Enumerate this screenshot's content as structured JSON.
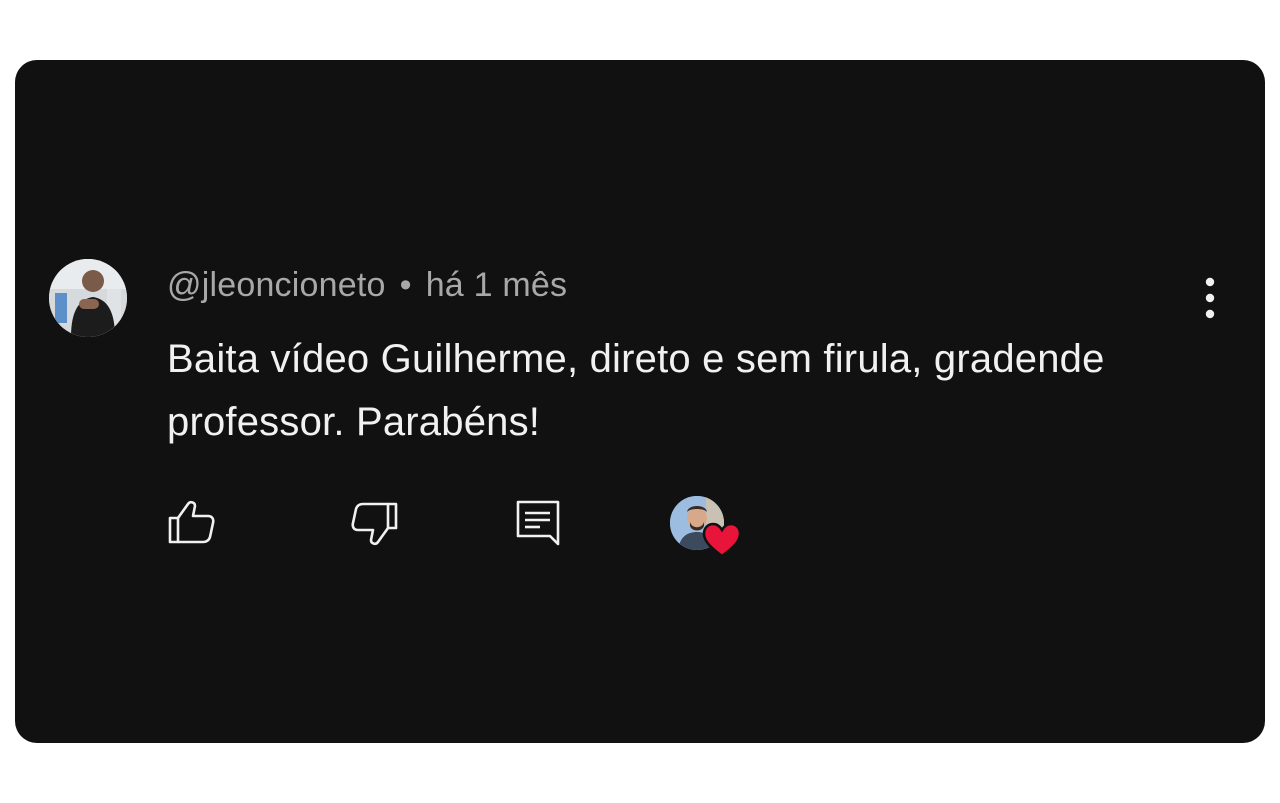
{
  "comment": {
    "author": "@jleoncioneto",
    "separator": "•",
    "time": "há 1 mês",
    "text": "Baita vídeo Guilherme, direto e sem firula, gradende professor. Parabéns!",
    "avatar_icon": "user-avatar",
    "more_icon": "more-vertical-icon"
  },
  "actions": {
    "like_icon": "thumbs-up-icon",
    "dislike_icon": "thumbs-down-icon",
    "reply_icon": "reply-icon",
    "creator_heart_icon": "heart-icon"
  },
  "colors": {
    "background": "#111112",
    "text_primary": "#f1f1f1",
    "text_secondary": "#a8a8a8",
    "heart": "#e8143a"
  }
}
